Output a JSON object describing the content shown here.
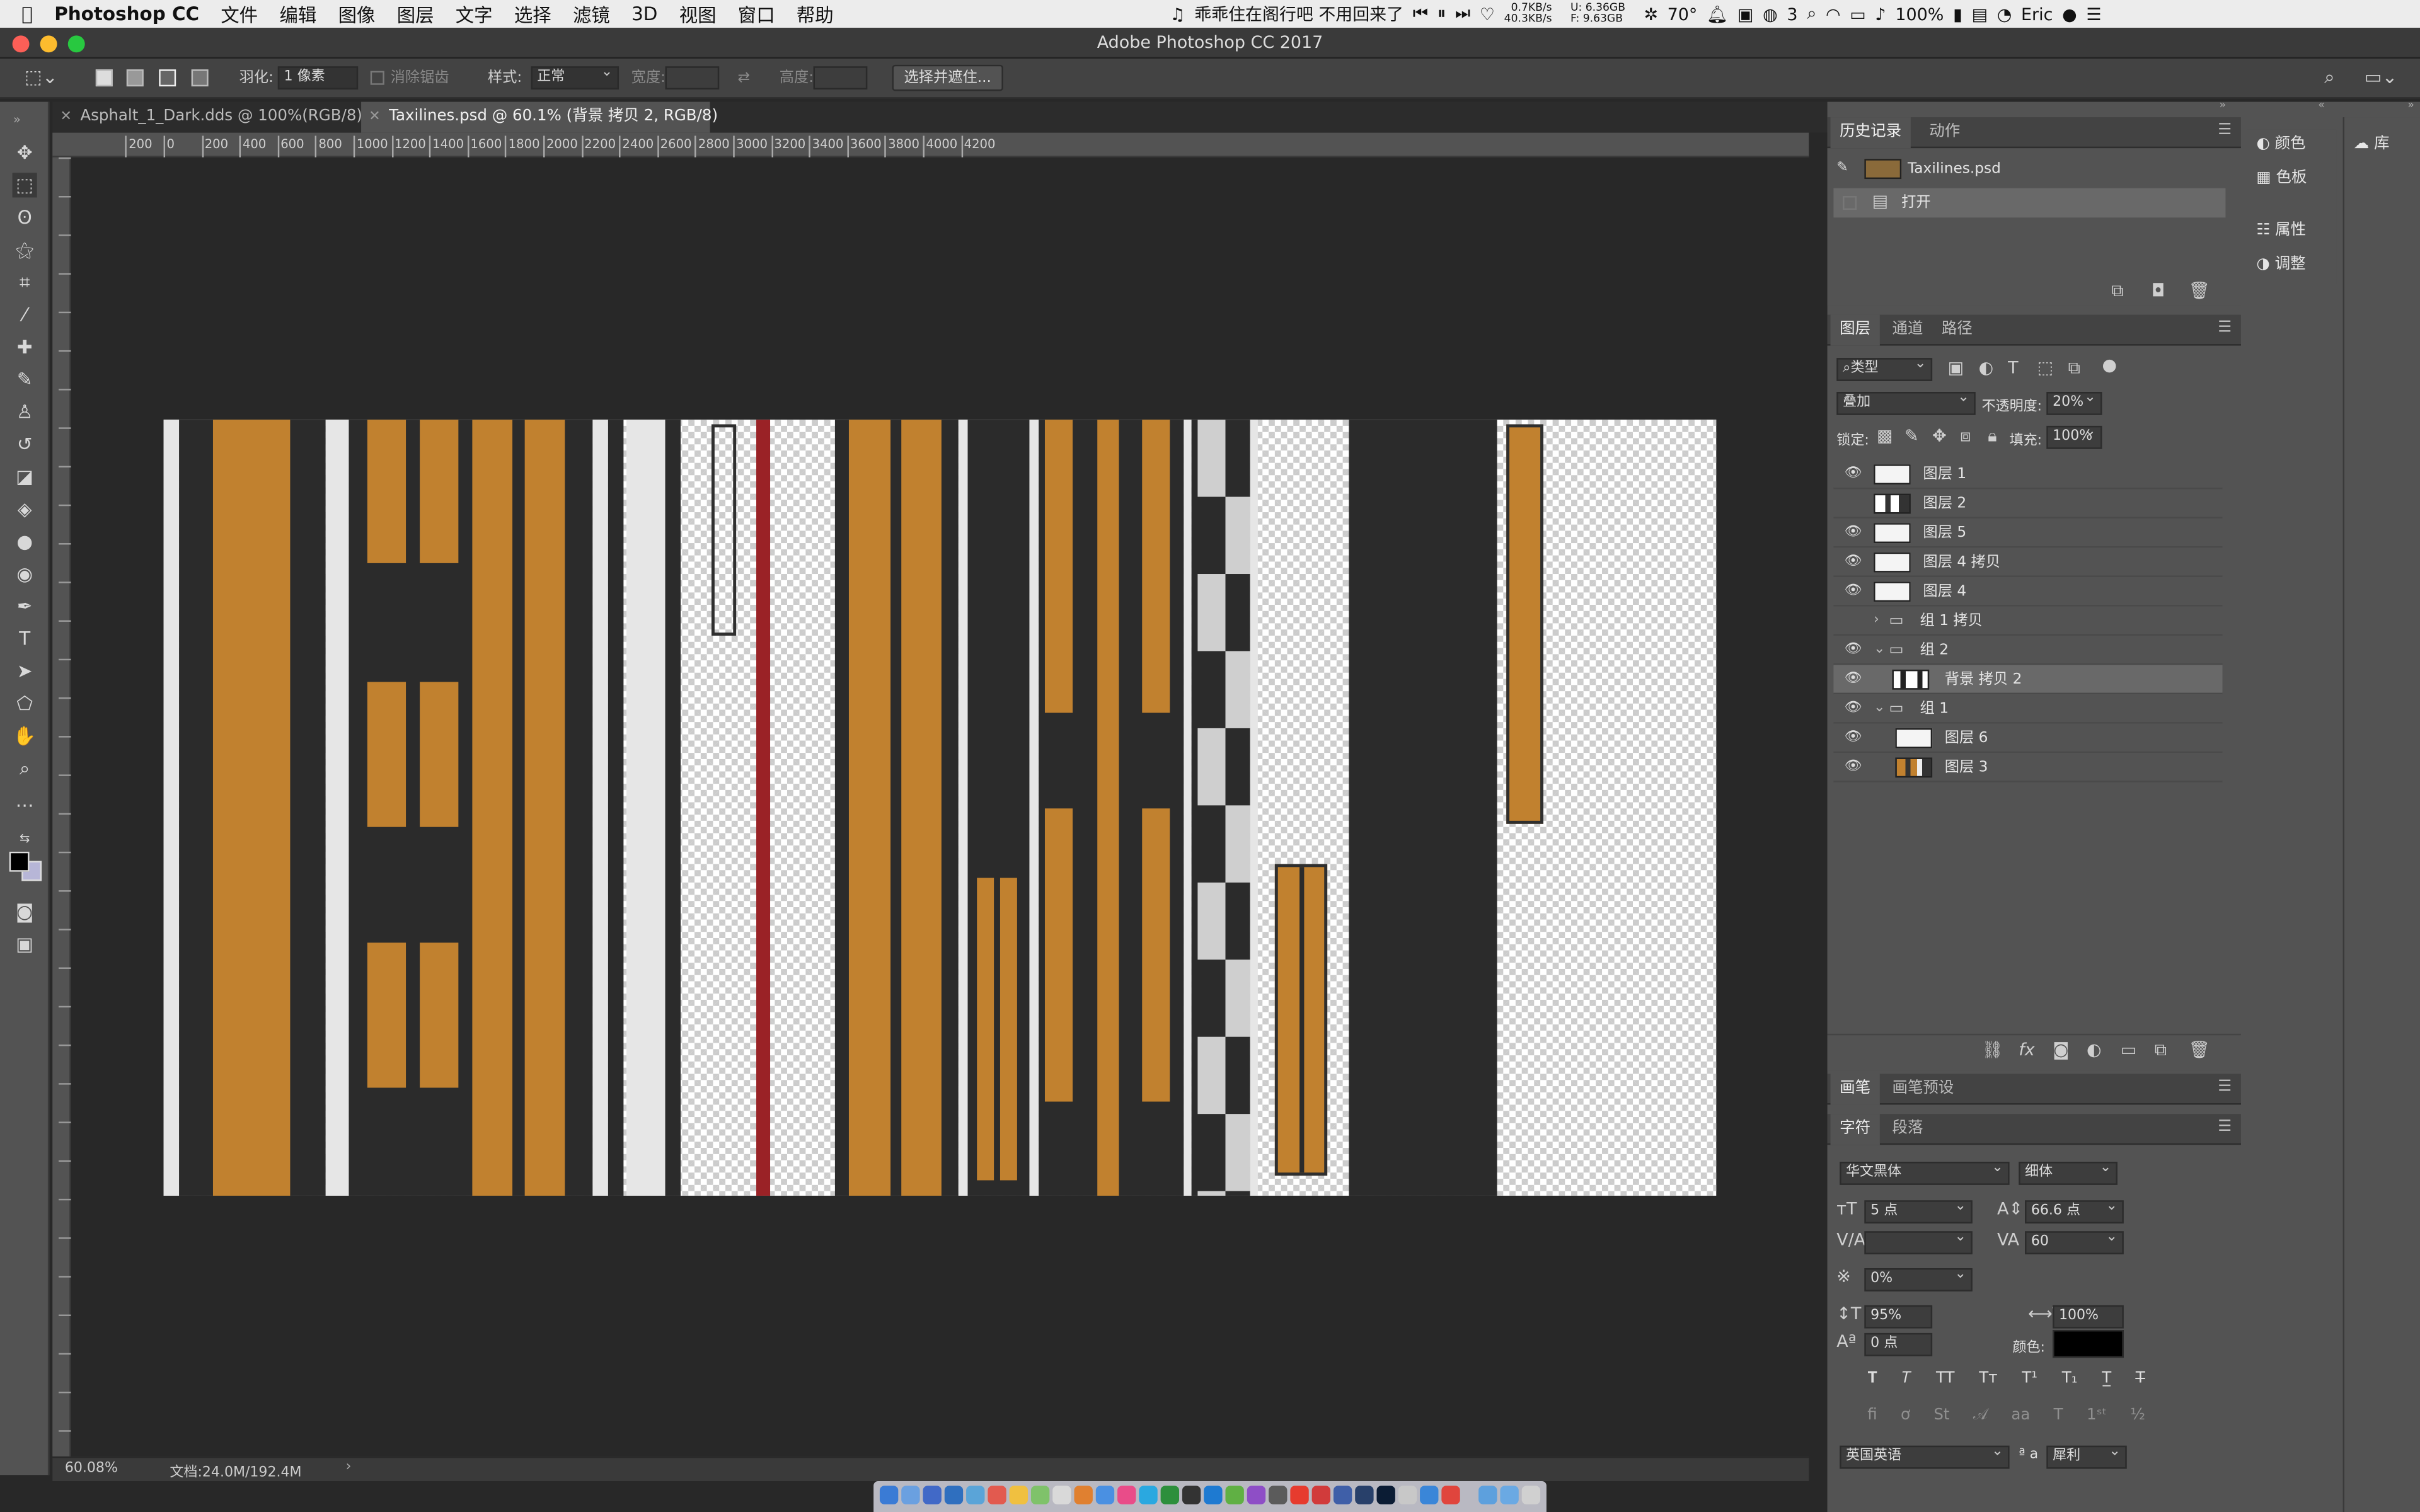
{
  "menubar": {
    "app_name": "Photoshop CC",
    "items": [
      "文件",
      "编辑",
      "图像",
      "图层",
      "文字",
      "选择",
      "滤镜",
      "3D",
      "视图",
      "窗口",
      "帮助"
    ],
    "now_playing": "乖乖住在阁行吧 不用回来了",
    "net_up": "0.7KB/s",
    "net_down": "40.3KB/s",
    "disk_u": "6.36GB",
    "disk_f": "9.63GB",
    "temp": "70°",
    "wechat_count": "3",
    "battery": "100%",
    "user": "Eric"
  },
  "titlebar": {
    "title": "Adobe Photoshop CC 2017"
  },
  "options": {
    "feather_label": "羽化:",
    "feather_value": "1 像素",
    "antialias_label": "消除锯齿",
    "style_label": "样式:",
    "style_value": "正常",
    "width_label": "宽度:",
    "height_label": "高度:",
    "select_mask_button": "选择并遮住..."
  },
  "tabs": [
    {
      "label": "Asphalt_1_Dark.dds @ 100%(RGB/8)"
    },
    {
      "label": "Taxilines.psd @ 60.1% (背景 拷贝 2, RGB/8)"
    }
  ],
  "ruler": {
    "h_ticks": [
      "200",
      "0",
      "200",
      "400",
      "600",
      "800",
      "1000",
      "1200",
      "1400",
      "1600",
      "1800",
      "2000",
      "2200",
      "2400",
      "2600",
      "2800",
      "3000",
      "3200",
      "3400",
      "3600",
      "3800",
      "4000",
      "4200"
    ]
  },
  "status": {
    "zoom": "60.08%",
    "doc_size": "文档:24.0M/192.4M"
  },
  "history": {
    "tabs": [
      "历史记录",
      "动作"
    ],
    "snapshot": "Taxilines.psd",
    "steps": [
      "打开"
    ]
  },
  "side_panel": {
    "items": [
      "颜色",
      "色板",
      "属性",
      "调整"
    ],
    "library": "库"
  },
  "layers": {
    "tabs": [
      "图层",
      "通道",
      "路径"
    ],
    "filter_kind": "类型",
    "blend_mode": "叠加",
    "opacity_label": "不透明度:",
    "opacity_value": "20%",
    "lock_label": "锁定:",
    "fill_label": "填充:",
    "fill_value": "100%",
    "items": [
      {
        "name": "图层 1",
        "visible": true
      },
      {
        "name": "图层 2",
        "visible": false
      },
      {
        "name": "图层 5",
        "visible": true
      },
      {
        "name": "图层 4 拷贝",
        "visible": true
      },
      {
        "name": "图层 4",
        "visible": true
      },
      {
        "name": "组 1 拷贝",
        "visible": false
      },
      {
        "name": "组 2",
        "visible": true
      },
      {
        "name": "背景 拷贝 2",
        "visible": true
      },
      {
        "name": "组 1",
        "visible": true
      },
      {
        "name": "图层 6",
        "visible": true
      },
      {
        "name": "图层 3",
        "visible": true
      }
    ]
  },
  "brush": {
    "tabs": [
      "画笔",
      "画笔预设"
    ]
  },
  "character": {
    "tabs": [
      "字符",
      "段落"
    ],
    "font_family": "华文黑体",
    "font_style": "细体",
    "font_size": "5 点",
    "leading": "66.6 点",
    "tracking": "60",
    "tsume": "0%",
    "vscale": "95%",
    "hscale": "100%",
    "baseline": "0 点",
    "color_label": "颜色:",
    "color": "#000000",
    "language": "英国英语",
    "aa_label": "ª a",
    "antialias": "犀利"
  }
}
